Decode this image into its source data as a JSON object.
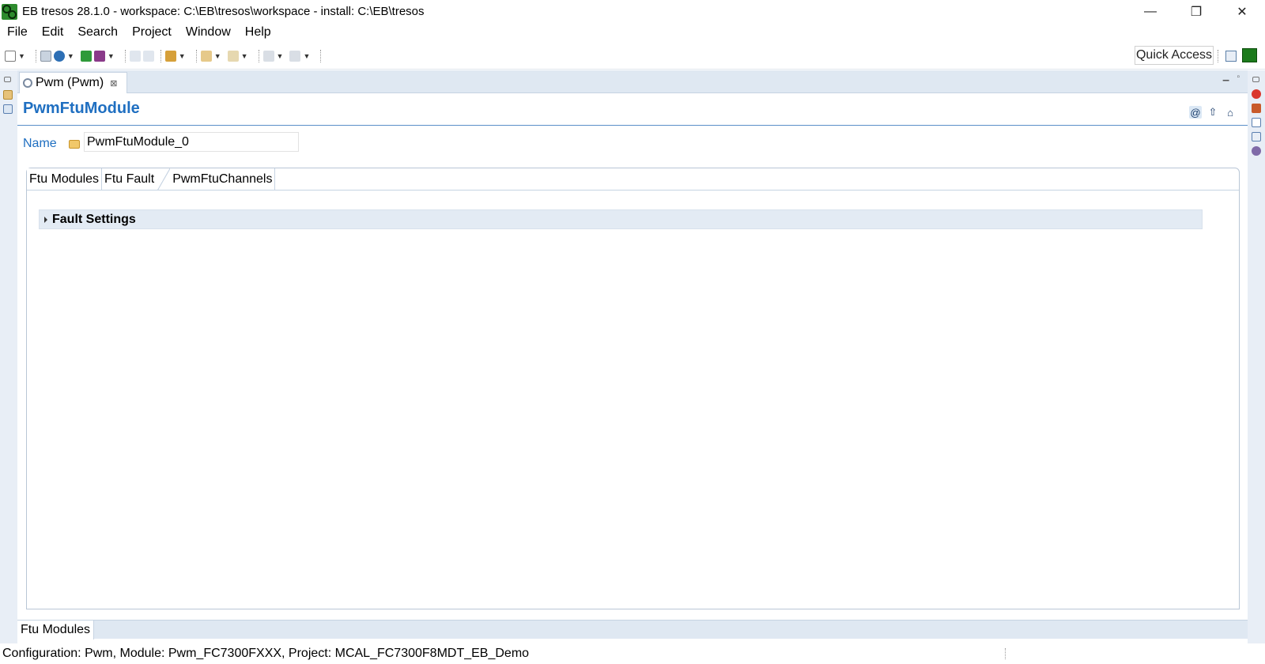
{
  "window": {
    "title": "EB tresos 28.1.0 - workspace: C:\\EB\\tresos\\workspace - install: C:\\EB\\tresos",
    "controls": {
      "minimize": "—",
      "restore": "❐",
      "close": "✕"
    }
  },
  "menu": [
    "File",
    "Edit",
    "Search",
    "Project",
    "Window",
    "Help"
  ],
  "toolbar": {
    "quick_access": "Quick Access",
    "icons": [
      "new-icon",
      "save-icon",
      "globe-icon",
      "generate-icon",
      "verify-icon",
      "undo-icon",
      "redo-icon",
      "pin-icon",
      "back-icon",
      "forward-icon",
      "import-icon",
      "export-icon"
    ]
  },
  "editor_tab": {
    "label": "Pwm (Pwm)",
    "close": "⊠"
  },
  "form": {
    "title": "PwmFtuModule",
    "name_label": "Name",
    "name_value": "PwmFtuModule_0",
    "tabs": [
      "Ftu Modules",
      "Ftu Fault",
      "PwmFtuChannels"
    ],
    "active_tab": "Ftu Fault",
    "section_title": "Fault Settings"
  },
  "page_tabs": [
    "Ftu Modules"
  ],
  "status": {
    "text": "Configuration: Pwm, Module: Pwm_FC7300FXXX, Project: MCAL_FC7300F8MDT_EB_Demo"
  },
  "colors": {
    "accent": "#1f6fc1",
    "trim": "#e8eef6",
    "section_bg": "#e3ebf4"
  }
}
